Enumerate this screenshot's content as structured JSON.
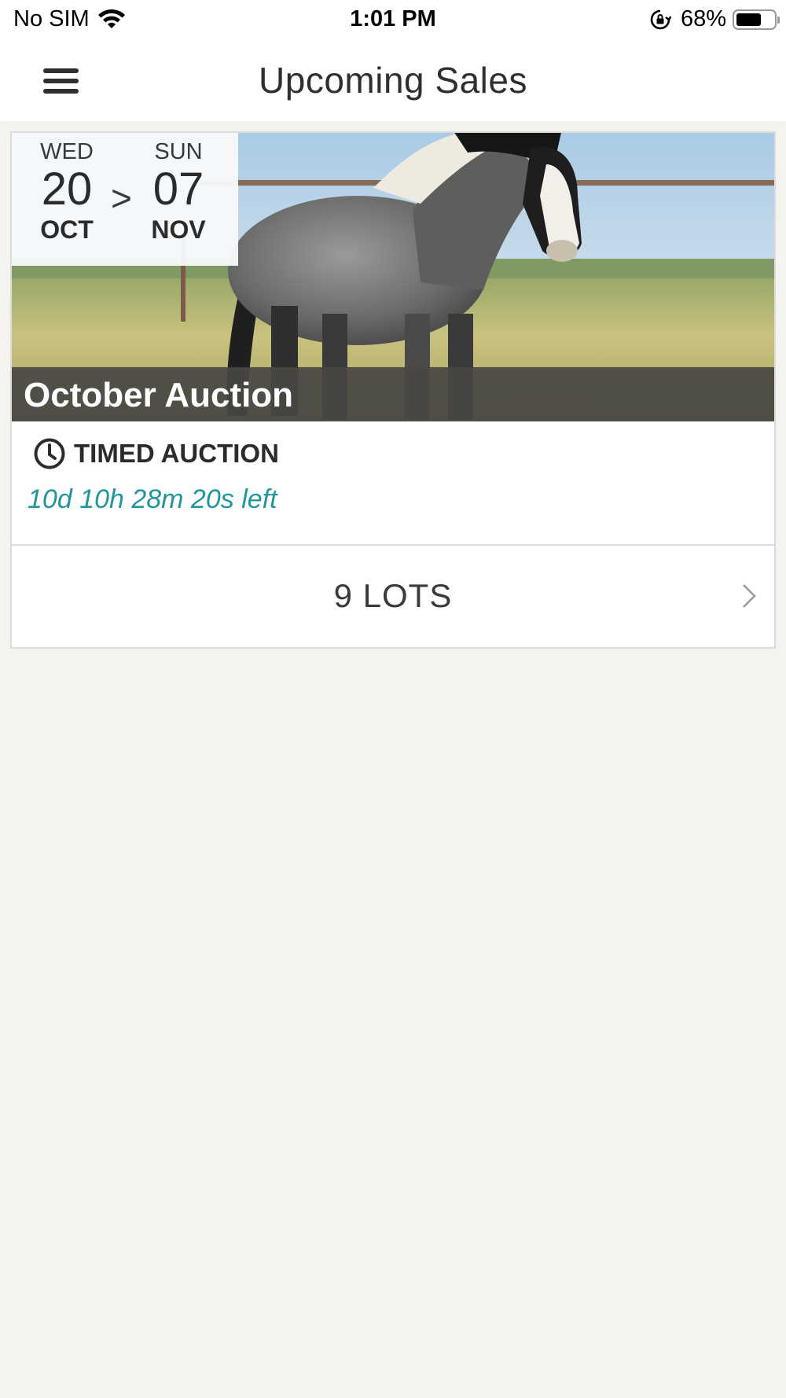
{
  "status_bar": {
    "carrier": "No SIM",
    "time": "1:01 PM",
    "battery_percent": "68%",
    "battery_level": 0.68,
    "icons": [
      "wifi-icon",
      "orientation-lock-icon",
      "battery-icon"
    ]
  },
  "nav": {
    "title": "Upcoming Sales",
    "menu_icon": "hamburger-menu-icon"
  },
  "sale": {
    "start": {
      "weekday": "WED",
      "day": "20",
      "month": "OCT"
    },
    "separator": ">",
    "end": {
      "weekday": "SUN",
      "day": "07",
      "month": "NOV"
    },
    "title": "October Auction",
    "auction_type": "TIMED AUCTION",
    "auction_type_icon": "clock-icon",
    "countdown": "10d 10h 28m 20s left",
    "lots_label": "9 LOTS",
    "lots_icon": "chevron-right-icon"
  },
  "colors": {
    "accent": "#23969b",
    "background": "#f4f3f0",
    "title_band": "#484642"
  }
}
